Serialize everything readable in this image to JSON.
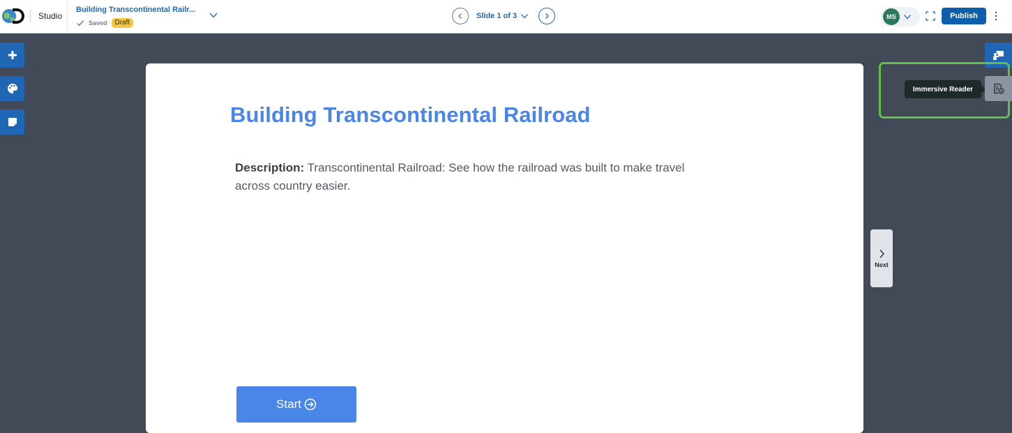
{
  "header": {
    "studio_label": "Studio",
    "doc_title": "Building Transcontinental Railr...",
    "saved_label": "Saved",
    "draft_badge": "Draft",
    "slide_indicator": "Slide 1 of 3",
    "user_initials": "MS",
    "publish_label": "Publish"
  },
  "toolbar": {
    "add_icon": "plus-icon",
    "theme_icon": "palette-icon",
    "notes_icon": "sticky-note-icon"
  },
  "slide": {
    "title": "Building Transcontinental Railroad",
    "description_label": "Description:",
    "description_text": " Transcontinental Railroad: See how the railroad was built to make travel across country easier.",
    "start_label": "Start"
  },
  "side": {
    "next_label": "Next",
    "tooltip": "Immersive Reader"
  },
  "colors": {
    "accent": "#1f67b5",
    "slide_title": "#4a85e8",
    "draft_badge": "#f6c744",
    "highlight": "#61c04a",
    "workspace": "#424957"
  }
}
